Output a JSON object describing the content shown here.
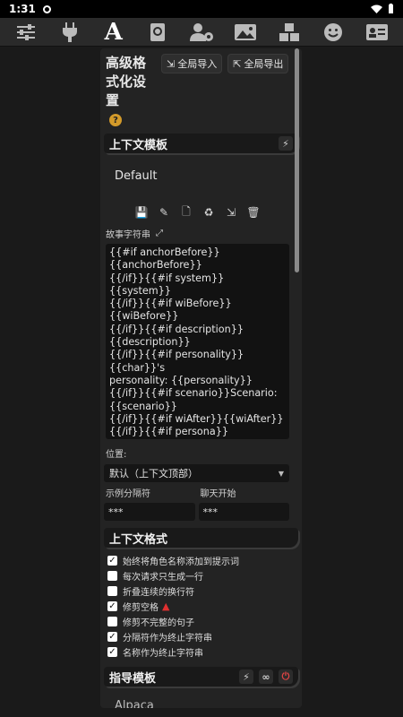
{
  "status": {
    "time": "1:31"
  },
  "topbar": {
    "icons": [
      "sliders-icon",
      "plug-icon",
      "font-a-icon",
      "book-globe-icon",
      "users-gear-icon",
      "image-icon",
      "cubes-icon",
      "smiley-icon",
      "id-card-icon"
    ],
    "active_glyph": "A"
  },
  "header": {
    "title": "高级格式化设置",
    "import_label": "全局导入",
    "export_label": "全局导出",
    "help": "?"
  },
  "context_template": {
    "section_title": "上下文模板",
    "preset": "Default",
    "story_label": "故事字符串",
    "story_string": "{{#if anchorBefore}}\n{{anchorBefore}}\n{{/if}}{{#if system}}{{system}}\n{{/if}}{{#if wiBefore}}{{wiBefore}}\n{{/if}}{{#if description}}\n{{description}}\n{{/if}}{{#if personality}}{{char}}'s\npersonality: {{personality}}\n{{/if}}{{#if scenario}}Scenario:\n{{scenario}}\n{{/if}}{{#if wiAfter}}{{wiAfter}}\n{{/if}}{{#if persona}}{{persona}}\n{{/if}}{{#if anchorAfter}}\n{{anchorAfter}}\n{{/if}}",
    "position_label": "位置:",
    "position_value": "默认（上下文顶部）",
    "example_sep_label": "示例分隔符",
    "example_sep_value": "***",
    "chat_start_label": "聊天开始",
    "chat_start_value": "***"
  },
  "context_format": {
    "section_title": "上下文格式",
    "options": [
      {
        "label": "始终将角色名称添加到提示词",
        "checked": true
      },
      {
        "label": "每次请求只生成一行",
        "checked": false
      },
      {
        "label": "折叠连续的换行符",
        "checked": false
      },
      {
        "label": "修剪空格",
        "checked": true,
        "warning": true
      },
      {
        "label": "修剪不完整的句子",
        "checked": false
      },
      {
        "label": "分隔符作为终止字符串",
        "checked": true
      },
      {
        "label": "名称作为终止字符串",
        "checked": true
      }
    ]
  },
  "instruct_template": {
    "section_title": "指导模板",
    "preset": "Alpaca"
  }
}
